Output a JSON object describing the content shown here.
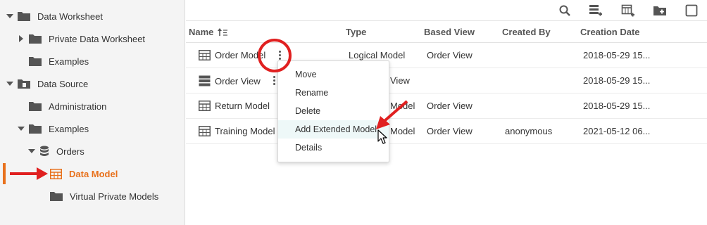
{
  "sidebar": {
    "items": [
      {
        "label": "Data Worksheet"
      },
      {
        "label": "Private Data Worksheet"
      },
      {
        "label": "Examples"
      },
      {
        "label": "Data Source"
      },
      {
        "label": "Administration"
      },
      {
        "label": "Examples"
      },
      {
        "label": "Orders"
      },
      {
        "label": "Data Model"
      },
      {
        "label": "Virtual Private Models"
      }
    ]
  },
  "toolbar": {
    "icons": [
      "search-icon",
      "new-worksheet-icon",
      "new-model-icon",
      "new-folder-icon",
      "select-all-checkbox"
    ]
  },
  "table": {
    "columns": [
      "Name",
      "Type",
      "Based View",
      "Created By",
      "Creation Date"
    ],
    "rows": [
      {
        "name": "Order Model",
        "type": "Logical Model",
        "based_view": "Order View",
        "created_by": "",
        "date": "2018-05-29 15..."
      },
      {
        "name": "Order View",
        "type": "Logical View",
        "based_view": "",
        "created_by": "",
        "date": "2018-05-29 15..."
      },
      {
        "name": "Return Model",
        "type": "Logical Model",
        "based_view": "Order View",
        "created_by": "",
        "date": "2018-05-29 15..."
      },
      {
        "name": "Training Model",
        "type": "Logical Model",
        "based_view": "Order View",
        "created_by": "anonymous",
        "date": "2021-05-12 06..."
      }
    ],
    "visible_type_fragments": [
      "View",
      "Model",
      "Model"
    ]
  },
  "context_menu": {
    "items": [
      {
        "label": "Move"
      },
      {
        "label": "Rename"
      },
      {
        "label": "Delete"
      },
      {
        "label": "Add Extended Model"
      },
      {
        "label": "Details"
      }
    ]
  },
  "colors": {
    "accent": "#e8711c",
    "annotation": "#e02020",
    "menu_hover": "#eef8f8"
  }
}
